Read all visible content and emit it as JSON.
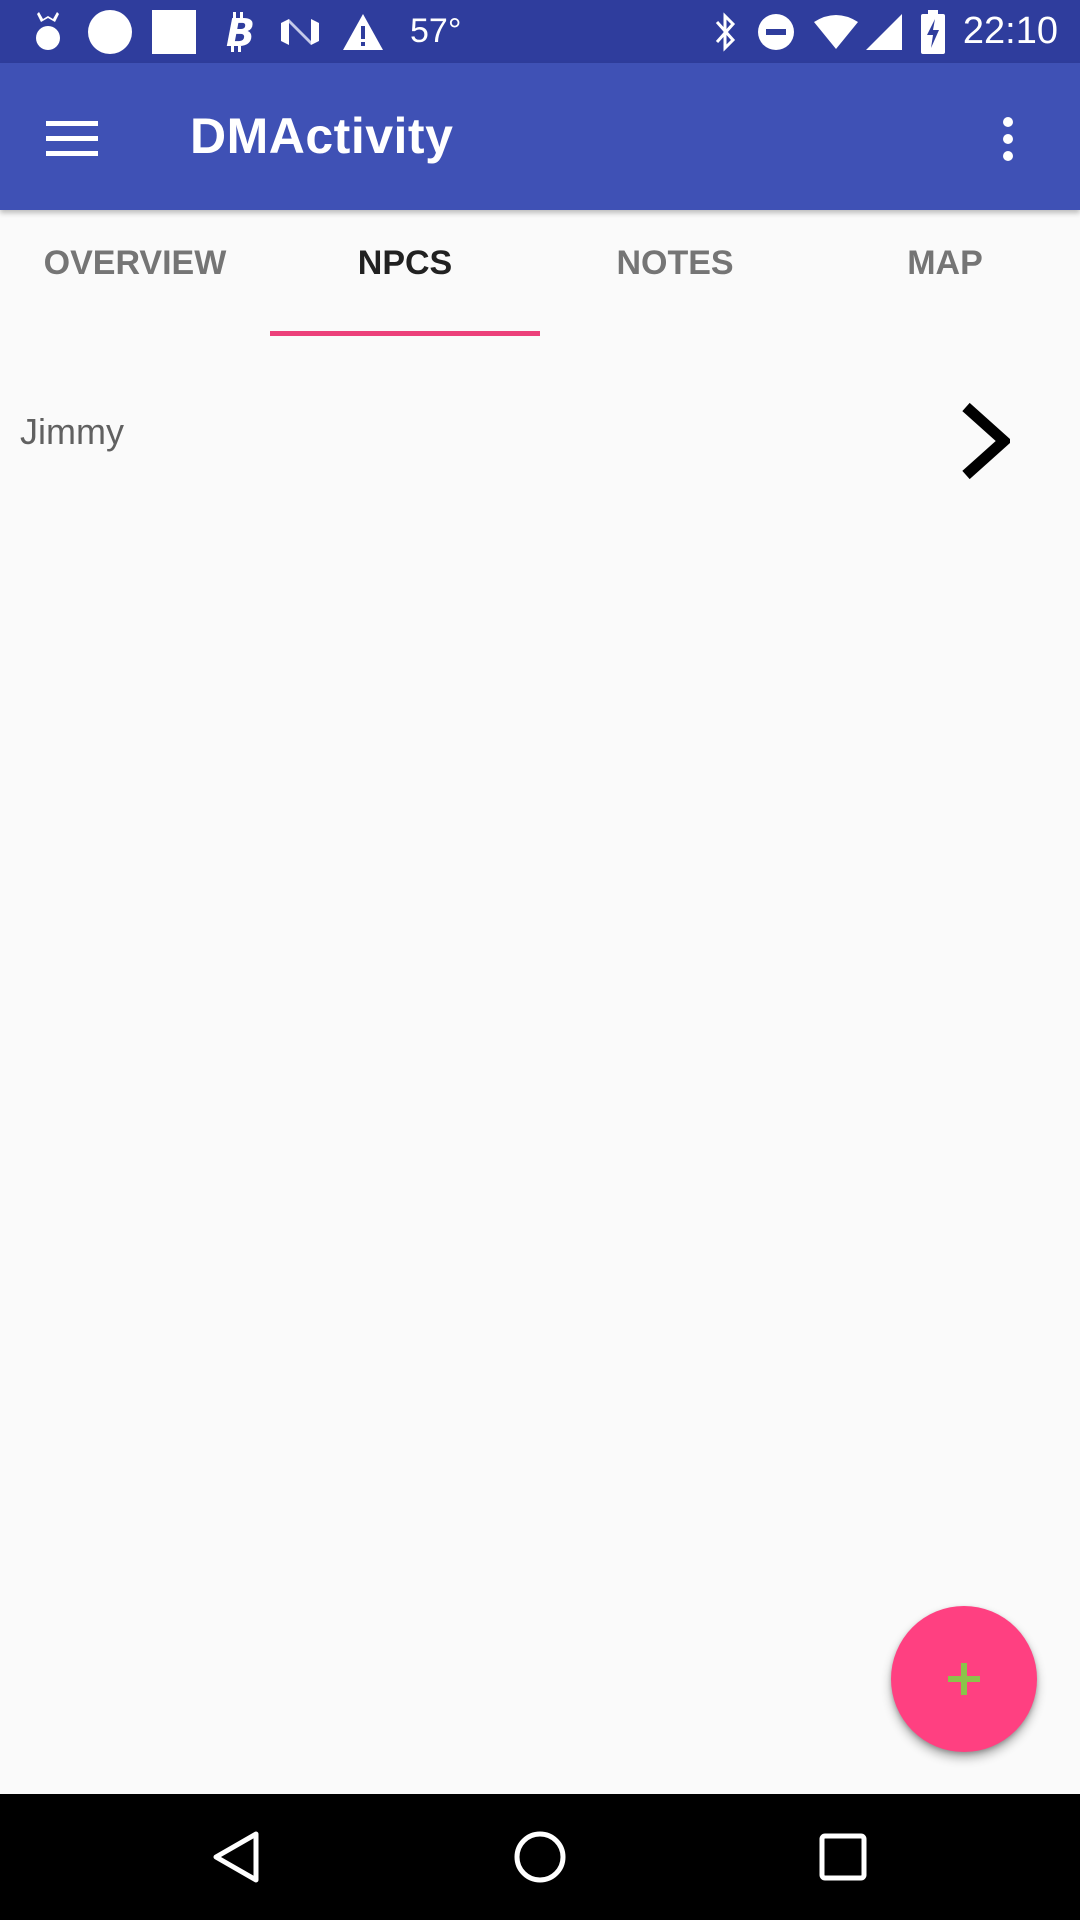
{
  "status_bar": {
    "temperature": "57°",
    "time": "22:10",
    "background_color": "#2f3d9d",
    "left_icons": [
      "fitness-icon",
      "circle-icon",
      "square-icon",
      "bitcoin-icon",
      "nfc-icon",
      "warning-icon"
    ],
    "right_icons": [
      "bluetooth-icon",
      "do-not-disturb-icon",
      "wifi-icon",
      "cell-signal-icon",
      "battery-charging-icon"
    ]
  },
  "app_bar": {
    "title": "DMActivity",
    "background_color": "#3f51b5",
    "menu_icon": "hamburger-menu-icon",
    "overflow_icon": "more-vert-icon"
  },
  "tabs": {
    "items": [
      {
        "label": "OVERVIEW",
        "active": false
      },
      {
        "label": "NPCS",
        "active": true
      },
      {
        "label": "NOTES",
        "active": false
      },
      {
        "label": "MAP",
        "active": false
      }
    ],
    "indicator_color": "#ec407a"
  },
  "npc_list": {
    "items": [
      {
        "name": "Jimmy",
        "icon": "chevron-right-icon"
      }
    ]
  },
  "fab": {
    "icon": "add-icon",
    "background_color": "#ff4081",
    "icon_color": "#8bc34a"
  },
  "nav_bar": {
    "icons": [
      "back-icon",
      "home-icon",
      "recents-icon"
    ]
  }
}
